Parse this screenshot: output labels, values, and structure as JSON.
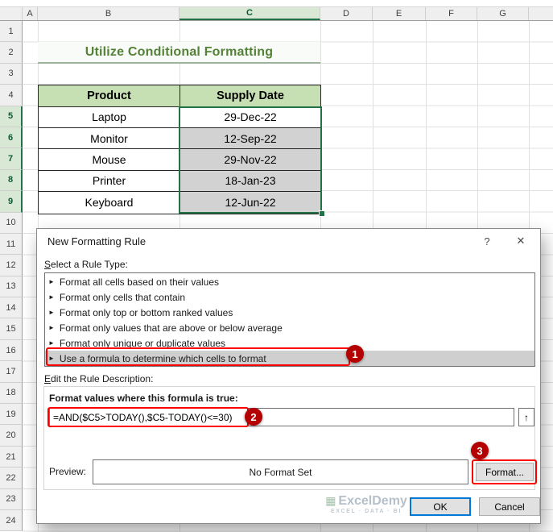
{
  "sheet": {
    "columns": [
      "A",
      "B",
      "C",
      "D",
      "E",
      "F",
      "G"
    ],
    "rows": [
      "1",
      "2",
      "3",
      "4",
      "5",
      "6",
      "7",
      "8",
      "9",
      "10",
      "11",
      "12",
      "13",
      "14",
      "15",
      "16",
      "17",
      "18",
      "19",
      "20",
      "21",
      "22",
      "23",
      "24"
    ],
    "title": "Utilize Conditional Formatting",
    "table": {
      "headers": [
        "Product",
        "Supply Date"
      ],
      "rows": [
        [
          "Laptop",
          "29-Dec-22"
        ],
        [
          "Monitor",
          "12-Sep-22"
        ],
        [
          "Mouse",
          "29-Nov-22"
        ],
        [
          "Printer",
          "18-Jan-23"
        ],
        [
          "Keyboard",
          "12-Jun-22"
        ]
      ]
    }
  },
  "dialog": {
    "title": "New Formatting Rule",
    "help_icon": "?",
    "close_icon": "✕",
    "rule_type_label": "Select a Rule Type:",
    "rule_types": [
      "Format all cells based on their values",
      "Format only cells that contain",
      "Format only top or bottom ranked values",
      "Format only values that are above or below average",
      "Format only unique or duplicate values",
      "Use a formula to determine which cells to format"
    ],
    "edit_description_label": "Edit the Rule Description:",
    "formula_label": "Format values where this formula is true:",
    "formula_value": "=AND($C5>TODAY(),$C5-TODAY()<=30)",
    "collapse_icon": "↑",
    "preview_label": "Preview:",
    "preview_value": "No Format Set",
    "format_button": "Format...",
    "ok_button": "OK",
    "cancel_button": "Cancel"
  },
  "annotations": {
    "step1": "1",
    "step2": "2",
    "step3": "3"
  },
  "icons": {
    "rule_arrow": "►"
  },
  "watermark": {
    "logo": "▦",
    "name": "ExcelDemy",
    "tagline": "EXCEL · DATA · BI"
  },
  "colors": {
    "excel_green": "#217346",
    "title_green": "#538135",
    "table_header_fill": "#C6E0B4",
    "selection_gray": "#D2D2D2",
    "annotation_red": "#B40000",
    "highlight_box_red": "#FE0000",
    "default_button_blue": "#0078D7"
  }
}
